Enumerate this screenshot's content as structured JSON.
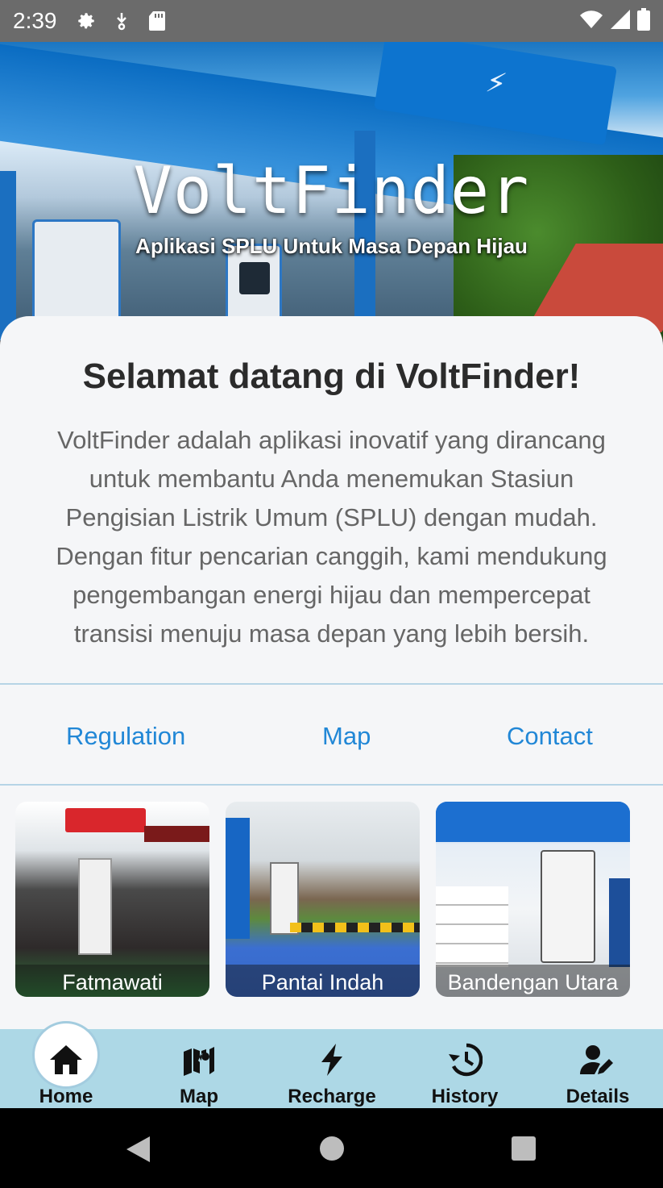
{
  "status_bar": {
    "time": "2:39",
    "icons": [
      "gear-icon",
      "download-icon",
      "sd-card-icon",
      "wifi-icon",
      "signal-icon",
      "battery-icon"
    ]
  },
  "hero": {
    "title": "VoltFinder",
    "subtitle": "Aplikasi SPLU Untuk Masa Depan Hijau"
  },
  "welcome": {
    "heading": "Selamat datang di VoltFinder!",
    "description": "VoltFinder adalah aplikasi inovatif yang dirancang untuk membantu Anda menemukan Stasiun Pengisian Listrik Umum (SPLU) dengan mudah. Dengan fitur pencarian canggih, kami mendukung pengembangan energi hijau dan mempercepat transisi menuju masa depan yang lebih bersih."
  },
  "links": [
    {
      "label": "Regulation"
    },
    {
      "label": "Map"
    },
    {
      "label": "Contact"
    }
  ],
  "locations": [
    {
      "name": "Fatmawati"
    },
    {
      "name": "Pantai Indah"
    },
    {
      "name": "Bandengan Utara"
    }
  ],
  "bottom_nav": [
    {
      "label": "Home",
      "icon": "home-icon",
      "active": true
    },
    {
      "label": "Map",
      "icon": "map-icon",
      "active": false
    },
    {
      "label": "Recharge",
      "icon": "bolt-icon",
      "active": false
    },
    {
      "label": "History",
      "icon": "history-icon",
      "active": false
    },
    {
      "label": "Details",
      "icon": "user-edit-icon",
      "active": false
    }
  ],
  "colors": {
    "status_bar": "#6b6b6b",
    "link": "#2187d6",
    "bottom_nav": "#add8e6",
    "card_bg": "#f5f6f8"
  }
}
